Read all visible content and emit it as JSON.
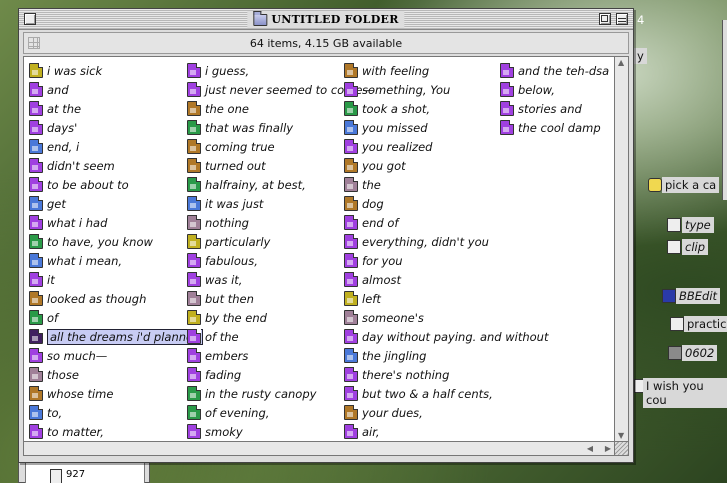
{
  "window": {
    "title": "UNTITLED FOLDER",
    "info": "64 items, 4.15 GB available"
  },
  "colors": {
    "purple": "#a040e0",
    "blue": "#4a78d8",
    "brown": "#b07828",
    "green": "#2a9a48",
    "olive": "#c0b020",
    "mauve": "#a08098",
    "dark": "#402060"
  },
  "columns": [
    [
      {
        "label": "i was sick",
        "color": "olive"
      },
      {
        "label": "and",
        "color": "purple"
      },
      {
        "label": "at the",
        "color": "purple"
      },
      {
        "label": "days'",
        "color": "purple"
      },
      {
        "label": "end, i",
        "color": "blue"
      },
      {
        "label": "didn't seem",
        "color": "purple"
      },
      {
        "label": "to be about to",
        "color": "purple"
      },
      {
        "label": "get",
        "color": "blue"
      },
      {
        "label": "what i had",
        "color": "purple"
      },
      {
        "label": "to have, you know",
        "color": "green"
      },
      {
        "label": "what i mean,",
        "color": "blue"
      },
      {
        "label": "it",
        "color": "purple"
      },
      {
        "label": "looked as though",
        "color": "brown"
      },
      {
        "label": "of",
        "color": "green"
      },
      {
        "label": "all the dreams i'd planned",
        "color": "dark",
        "selected": true
      },
      {
        "label": "so much—",
        "color": "purple"
      },
      {
        "label": "those",
        "color": "mauve"
      },
      {
        "label": "whose time",
        "color": "brown"
      },
      {
        "label": "to,",
        "color": "blue"
      },
      {
        "label": "to matter,",
        "color": "purple"
      }
    ],
    [
      {
        "label": "i guess,",
        "color": "purple"
      },
      {
        "label": "just never seemed to come—",
        "color": "purple"
      },
      {
        "label": "the one",
        "color": "brown"
      },
      {
        "label": "that was finally",
        "color": "green"
      },
      {
        "label": "coming true",
        "color": "brown"
      },
      {
        "label": "turned out",
        "color": "brown"
      },
      {
        "label": "halfrainy, at best,",
        "color": "green"
      },
      {
        "label": "it was just",
        "color": "blue"
      },
      {
        "label": "nothing",
        "color": "mauve"
      },
      {
        "label": "particularly",
        "color": "olive"
      },
      {
        "label": "fabulous,",
        "color": "purple"
      },
      {
        "label": "was it,",
        "color": "purple"
      },
      {
        "label": "but then",
        "color": "mauve"
      },
      {
        "label": "by the end",
        "color": "olive"
      },
      {
        "label": "of the",
        "color": "purple"
      },
      {
        "label": "embers",
        "color": "purple"
      },
      {
        "label": "fading",
        "color": "purple"
      },
      {
        "label": "in the rusty canopy",
        "color": "green"
      },
      {
        "label": "of evening,",
        "color": "green"
      },
      {
        "label": "smoky",
        "color": "purple"
      }
    ],
    [
      {
        "label": "with feeling",
        "color": "brown"
      },
      {
        "label": "something, You",
        "color": "purple"
      },
      {
        "label": "took a shot,",
        "color": "green"
      },
      {
        "label": "you missed",
        "color": "blue"
      },
      {
        "label": "you realized",
        "color": "purple"
      },
      {
        "label": "you got",
        "color": "brown"
      },
      {
        "label": "the",
        "color": "mauve"
      },
      {
        "label": "dog",
        "color": "brown"
      },
      {
        "label": "end of",
        "color": "purple"
      },
      {
        "label": "everything, didn't you",
        "color": "purple"
      },
      {
        "label": "for you",
        "color": "purple"
      },
      {
        "label": "almost",
        "color": "purple"
      },
      {
        "label": "left",
        "color": "olive"
      },
      {
        "label": "someone's",
        "color": "mauve"
      },
      {
        "label": "day without paying. and without",
        "color": "purple"
      },
      {
        "label": "the jingling",
        "color": "blue"
      },
      {
        "label": "there's nothing",
        "color": "purple"
      },
      {
        "label": "but two & a half cents,",
        "color": "purple"
      },
      {
        "label": "your dues,",
        "color": "brown"
      },
      {
        "label": "air,",
        "color": "purple"
      }
    ],
    [
      {
        "label": "and the teh-dsa",
        "color": "purple"
      },
      {
        "label": "below,",
        "color": "purple"
      },
      {
        "label": "stories and",
        "color": "purple"
      },
      {
        "label": "the cool damp",
        "color": "purple"
      }
    ]
  ],
  "desktop": {
    "items": [
      {
        "label": "pick a ca",
        "italic": false
      },
      {
        "label": "type",
        "italic": true
      },
      {
        "label": "clip",
        "italic": true
      },
      {
        "label": "BBEdit",
        "italic": true
      },
      {
        "label": "practic",
        "italic": false
      },
      {
        "label": "0602",
        "italic": true
      },
      {
        "label": "I wish you cou",
        "italic": false
      }
    ],
    "bg_window_item": "927",
    "edge_text_1": "4",
    "edge_text_2": "y"
  }
}
